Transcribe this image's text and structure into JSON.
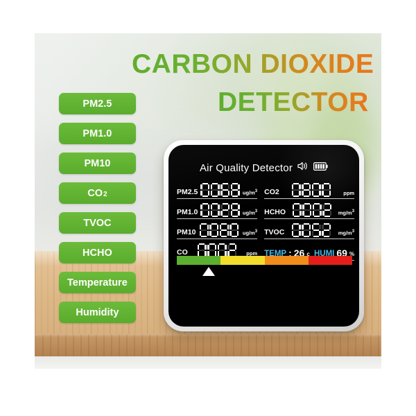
{
  "headline": {
    "line1": "CARBON DIOXIDE",
    "line2": "DETECTOR"
  },
  "badges": [
    {
      "label": "PM2.5",
      "sub": ""
    },
    {
      "label": "PM1.0",
      "sub": ""
    },
    {
      "label": "PM10",
      "sub": ""
    },
    {
      "label": "CO",
      "sub": "2"
    },
    {
      "label": "TVOC",
      "sub": ""
    },
    {
      "label": "HCHO",
      "sub": ""
    },
    {
      "label": "Temperature",
      "sub": ""
    },
    {
      "label": "Humidity",
      "sub": ""
    }
  ],
  "device": {
    "screen_title": "Air Quality Detector",
    "speaker_icon": "speaker-icon",
    "battery_icon": "battery-icon",
    "battery_bars": 4,
    "left_column": [
      {
        "label": "PM2.5",
        "value": "0068",
        "unit": "ug/m",
        "unit_sup": "3"
      },
      {
        "label": "PM1.0",
        "value": "0028",
        "unit": "ug/m",
        "unit_sup": "3"
      },
      {
        "label": "PM10",
        "value": "0080",
        "unit": "ug/m",
        "unit_sup": "3"
      },
      {
        "label": "CO",
        "value": "0002",
        "unit": "ppm",
        "unit_sup": ""
      }
    ],
    "right_column": [
      {
        "label": "CO2",
        "value": "0800",
        "unit": "ppm",
        "unit_sup": ""
      },
      {
        "label": "HCHO",
        "value": "0002",
        "unit": "mg/m",
        "unit_sup": "3"
      },
      {
        "label": "TVOC",
        "value": "0052",
        "unit": "mg/m",
        "unit_sup": "3"
      }
    ],
    "temp_humidity": {
      "temp_label": "TEMP",
      "temp_separator": ":",
      "temp_value": "26",
      "temp_unit": "c",
      "humi_label": "HUMI",
      "humi_value": "69",
      "humi_unit": "%"
    },
    "quality_bar": {
      "segments": [
        "#5cb030",
        "#f2dd2c",
        "#ef8c1c",
        "#e41f1a"
      ],
      "pointer_percent": 18
    }
  },
  "colors": {
    "badge_green": "#5cb030",
    "headline_green": "#5fae2e",
    "headline_orange": "#e8771c",
    "cyan": "#49b7e8"
  }
}
